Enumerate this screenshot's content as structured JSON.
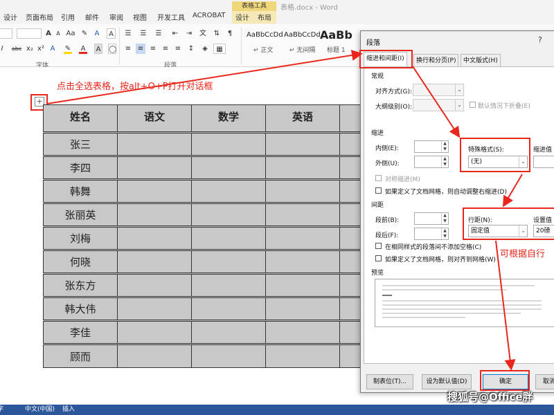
{
  "ribbon_tabs": {
    "tool_group": "表格工具",
    "doc_title": "表格.docx - Word",
    "items": [
      "设计",
      "页面布局",
      "引用",
      "邮件",
      "审阅",
      "视图",
      "开发工具",
      "ACROBAT",
      "设计",
      "布局"
    ]
  },
  "ribbon": {
    "font_group_label": "字体",
    "paragraph_group_label": "段落",
    "font_buttons": [
      "A",
      "A",
      "Aa",
      "A",
      "A"
    ],
    "format_buttons": [
      "I",
      "abc",
      "x₂",
      "x²",
      "A",
      "A",
      "A"
    ],
    "styles": [
      {
        "preview": "AaBbCcDd",
        "name": "↵ 正文"
      },
      {
        "preview": "AaBbCcDd",
        "name": "↵ 无间隔"
      },
      {
        "preview": "AaBb",
        "name": "标题 1"
      }
    ]
  },
  "document": {
    "annotation": "点击全选表格，按alt+O+P打开对话框",
    "table_handle": "+",
    "table_headers": [
      "姓名",
      "语文",
      "数学",
      "英语",
      ""
    ],
    "table_names": [
      "张三",
      "李四",
      "韩舞",
      "张丽英",
      "刘梅",
      "何晓",
      "张东方",
      "韩大伟",
      "李佳",
      "顾而"
    ]
  },
  "dialog": {
    "title": "段落",
    "help": "?",
    "tabs": [
      "缩进和间距(I)",
      "换行和分页(P)",
      "中文版式(H)"
    ],
    "general_section": "常规",
    "alignment_label": "对齐方式(G):",
    "outline_label": "大纲级别(O):",
    "collapse_label": "默认情况下折叠(E)",
    "indent_section": "缩进",
    "inside_label": "内侧(E):",
    "outside_label": "外侧(U):",
    "special_label": "特殊格式(S):",
    "special_value": "(无)",
    "indent_value_label": "缩进值",
    "mirror_label": "对称缩进(M)",
    "grid_indent_label": "如果定义了文档网格，则自动调整右缩进(D)",
    "spacing_section": "间距",
    "before_label": "段前(B):",
    "after_label": "段后(F):",
    "line_spacing_label": "行距(N):",
    "line_spacing_value": "固定值",
    "set_value_label": "设置值",
    "set_value": "20磅",
    "no_space_label": "在相同样式的段落间不添加空格(C)",
    "snap_grid_label": "如果定义了文档网格，则对齐到网格(W)",
    "preview_section": "预览",
    "buttons": {
      "tabs": "制表位(T)...",
      "set_default": "设为默认值(D)",
      "ok": "确定",
      "cancel": "取消"
    }
  },
  "annotation2": "可根据自行",
  "status_bar": [
    "字",
    "中文(中国)",
    "插入"
  ],
  "watermark": "搜狐号@Office胖"
}
